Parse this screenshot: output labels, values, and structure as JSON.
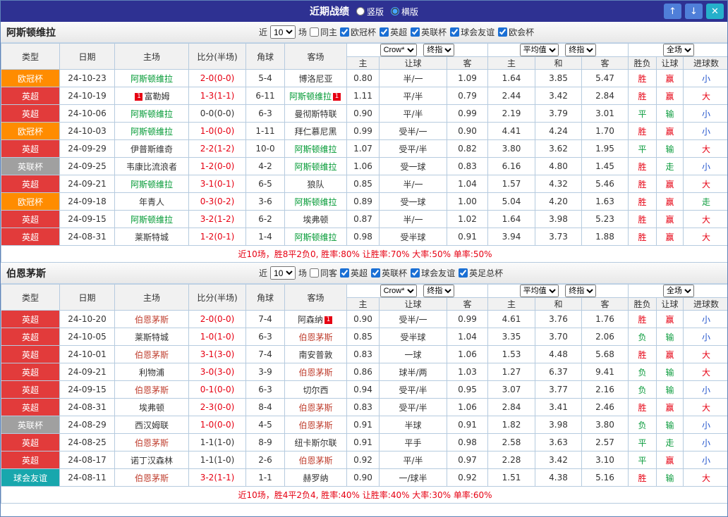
{
  "titlebar": {
    "title": "近期战绩",
    "layout_options": [
      {
        "label": "竖版",
        "selected": false
      },
      {
        "label": "横版",
        "selected": true
      }
    ],
    "buttons": {
      "up": "↑",
      "down": "↓",
      "close": "✕"
    }
  },
  "thead": {
    "type": "类型",
    "date": "日期",
    "home": "主场",
    "score": "比分(半场)",
    "corner": "角球",
    "away": "客场",
    "odds_home": "主",
    "odds_handicap": "让球",
    "odds_away": "客",
    "avg_home": "主",
    "avg_draw": "和",
    "avg_away": "客",
    "res_wl": "胜负",
    "res_handicap": "让球",
    "res_goals": "进球数"
  },
  "colors": {
    "league": {
      "欧冠杯": "#ff8c00",
      "英超": "#e23b3b",
      "英联杯": "#a0a0a0",
      "球会友谊": "#18a7ad"
    },
    "result": {
      "胜": "#e60012",
      "平": "#0a9b3c",
      "负": "#0a9b3c",
      "赢": "#e60012",
      "输": "#0a9b3c",
      "走": "#0a9b3c",
      "大": "#e60012",
      "小": "#2153cc"
    },
    "score_red": "#e60012",
    "score_plain": "#333333",
    "badge": "#e60012"
  },
  "sections": [
    {
      "team": "阿斯顿维拉",
      "team_color": "#009933",
      "filter": {
        "near": "近",
        "count": "10",
        "games": "场",
        "same": {
          "label": "同主",
          "checked": false
        },
        "leagues": [
          {
            "label": "欧冠杯",
            "checked": true
          },
          {
            "label": "英超",
            "checked": true
          },
          {
            "label": "英联杯",
            "checked": true
          },
          {
            "label": "球会友谊",
            "checked": true
          },
          {
            "label": "欧会杯",
            "checked": true
          }
        ]
      },
      "selects": {
        "odds_source": "Crow*",
        "odds_time": "终指",
        "avg_source": "平均值",
        "avg_time": "终指",
        "scope": "全场"
      },
      "rows": [
        {
          "type": "欧冠杯",
          "date": "24-10-23",
          "home": "阿斯顿维拉",
          "homeFocus": true,
          "score": "2-0(0-0)",
          "scoreRed": true,
          "corner": "5-4",
          "away": "博洛尼亚",
          "odds": [
            "0.80",
            "半/一",
            "1.09"
          ],
          "avg": [
            "1.64",
            "3.85",
            "5.47"
          ],
          "res": [
            "胜",
            "赢",
            "小"
          ]
        },
        {
          "type": "英超",
          "date": "24-10-19",
          "home": "富勒姆",
          "homeBadge": "1",
          "homeBadgeSide": "left",
          "score": "1-3(1-1)",
          "scoreRed": true,
          "corner": "6-11",
          "away": "阿斯顿维拉",
          "awayFocus": true,
          "awayBadge": "1",
          "awayBadgeSide": "right",
          "odds": [
            "1.11",
            "平/半",
            "0.79"
          ],
          "avg": [
            "2.44",
            "3.42",
            "2.84"
          ],
          "res": [
            "胜",
            "赢",
            "大"
          ]
        },
        {
          "type": "英超",
          "date": "24-10-06",
          "home": "阿斯顿维拉",
          "homeFocus": true,
          "score": "0-0(0-0)",
          "scoreRed": false,
          "corner": "6-3",
          "away": "曼彻斯特联",
          "odds": [
            "0.90",
            "平/半",
            "0.99"
          ],
          "avg": [
            "2.19",
            "3.79",
            "3.01"
          ],
          "res": [
            "平",
            "输",
            "小"
          ]
        },
        {
          "type": "欧冠杯",
          "date": "24-10-03",
          "home": "阿斯顿维拉",
          "homeFocus": true,
          "score": "1-0(0-0)",
          "scoreRed": true,
          "corner": "1-11",
          "away": "拜仁慕尼黑",
          "odds": [
            "0.99",
            "受半/一",
            "0.90"
          ],
          "avg": [
            "4.41",
            "4.24",
            "1.70"
          ],
          "res": [
            "胜",
            "赢",
            "小"
          ]
        },
        {
          "type": "英超",
          "date": "24-09-29",
          "home": "伊普斯维奇",
          "score": "2-2(1-2)",
          "scoreRed": true,
          "corner": "10-0",
          "away": "阿斯顿维拉",
          "awayFocus": true,
          "odds": [
            "1.07",
            "受平/半",
            "0.82"
          ],
          "avg": [
            "3.80",
            "3.62",
            "1.95"
          ],
          "res": [
            "平",
            "输",
            "大"
          ]
        },
        {
          "type": "英联杯",
          "date": "24-09-25",
          "home": "韦康比流浪者",
          "score": "1-2(0-0)",
          "scoreRed": true,
          "corner": "4-2",
          "away": "阿斯顿维拉",
          "awayFocus": true,
          "odds": [
            "1.06",
            "受一球",
            "0.83"
          ],
          "avg": [
            "6.16",
            "4.80",
            "1.45"
          ],
          "res": [
            "胜",
            "走",
            "小"
          ]
        },
        {
          "type": "英超",
          "date": "24-09-21",
          "home": "阿斯顿维拉",
          "homeFocus": true,
          "score": "3-1(0-1)",
          "scoreRed": true,
          "corner": "6-5",
          "away": "狼队",
          "odds": [
            "0.85",
            "半/一",
            "1.04"
          ],
          "avg": [
            "1.57",
            "4.32",
            "5.46"
          ],
          "res": [
            "胜",
            "赢",
            "大"
          ]
        },
        {
          "type": "欧冠杯",
          "date": "24-09-18",
          "home": "年青人",
          "score": "0-3(0-2)",
          "scoreRed": true,
          "corner": "3-6",
          "away": "阿斯顿维拉",
          "awayFocus": true,
          "odds": [
            "0.89",
            "受一球",
            "1.00"
          ],
          "avg": [
            "5.04",
            "4.20",
            "1.63"
          ],
          "res": [
            "胜",
            "赢",
            "走"
          ]
        },
        {
          "type": "英超",
          "date": "24-09-15",
          "home": "阿斯顿维拉",
          "homeFocus": true,
          "score": "3-2(1-2)",
          "scoreRed": true,
          "corner": "6-2",
          "away": "埃弗顿",
          "odds": [
            "0.87",
            "半/一",
            "1.02"
          ],
          "avg": [
            "1.64",
            "3.98",
            "5.23"
          ],
          "res": [
            "胜",
            "赢",
            "大"
          ]
        },
        {
          "type": "英超",
          "date": "24-08-31",
          "home": "莱斯特城",
          "score": "1-2(0-1)",
          "scoreRed": true,
          "corner": "1-4",
          "away": "阿斯顿维拉",
          "awayFocus": true,
          "odds": [
            "0.98",
            "受半球",
            "0.91"
          ],
          "avg": [
            "3.94",
            "3.73",
            "1.88"
          ],
          "res": [
            "胜",
            "赢",
            "大"
          ]
        }
      ],
      "summary": "近10场，胜8平2负0, 胜率:80% 让胜率:70% 大率:50% 单率:50%"
    },
    {
      "team": "伯恩茅斯",
      "team_color": "#c04030",
      "filter": {
        "near": "近",
        "count": "10",
        "games": "场",
        "same": {
          "label": "同客",
          "checked": false
        },
        "leagues": [
          {
            "label": "英超",
            "checked": true
          },
          {
            "label": "英联杯",
            "checked": true
          },
          {
            "label": "球会友谊",
            "checked": true
          },
          {
            "label": "英足总杯",
            "checked": true
          }
        ]
      },
      "selects": {
        "odds_source": "Crow*",
        "odds_time": "终指",
        "avg_source": "平均值",
        "avg_time": "终指",
        "scope": "全场"
      },
      "rows": [
        {
          "type": "英超",
          "date": "24-10-20",
          "home": "伯恩茅斯",
          "homeFocus": true,
          "score": "2-0(0-0)",
          "scoreRed": true,
          "corner": "7-4",
          "away": "阿森纳",
          "awayBadge": "1",
          "awayBadgeSide": "right",
          "odds": [
            "0.90",
            "受半/一",
            "0.99"
          ],
          "avg": [
            "4.61",
            "3.76",
            "1.76"
          ],
          "res": [
            "胜",
            "赢",
            "小"
          ]
        },
        {
          "type": "英超",
          "date": "24-10-05",
          "home": "莱斯特城",
          "score": "1-0(1-0)",
          "scoreRed": true,
          "corner": "6-3",
          "away": "伯恩茅斯",
          "awayFocus": true,
          "odds": [
            "0.85",
            "受半球",
            "1.04"
          ],
          "avg": [
            "3.35",
            "3.70",
            "2.06"
          ],
          "res": [
            "负",
            "输",
            "小"
          ]
        },
        {
          "type": "英超",
          "date": "24-10-01",
          "home": "伯恩茅斯",
          "homeFocus": true,
          "score": "3-1(3-0)",
          "scoreRed": true,
          "corner": "7-4",
          "away": "南安普敦",
          "odds": [
            "0.83",
            "一球",
            "1.06"
          ],
          "avg": [
            "1.53",
            "4.48",
            "5.68"
          ],
          "res": [
            "胜",
            "赢",
            "大"
          ]
        },
        {
          "type": "英超",
          "date": "24-09-21",
          "home": "利物浦",
          "score": "3-0(3-0)",
          "scoreRed": true,
          "corner": "3-9",
          "away": "伯恩茅斯",
          "awayFocus": true,
          "odds": [
            "0.86",
            "球半/两",
            "1.03"
          ],
          "avg": [
            "1.27",
            "6.37",
            "9.41"
          ],
          "res": [
            "负",
            "输",
            "大"
          ]
        },
        {
          "type": "英超",
          "date": "24-09-15",
          "home": "伯恩茅斯",
          "homeFocus": true,
          "score": "0-1(0-0)",
          "scoreRed": true,
          "corner": "6-3",
          "away": "切尔西",
          "odds": [
            "0.94",
            "受平/半",
            "0.95"
          ],
          "avg": [
            "3.07",
            "3.77",
            "2.16"
          ],
          "res": [
            "负",
            "输",
            "小"
          ]
        },
        {
          "type": "英超",
          "date": "24-08-31",
          "home": "埃弗顿",
          "score": "2-3(0-0)",
          "scoreRed": true,
          "corner": "8-4",
          "away": "伯恩茅斯",
          "awayFocus": true,
          "odds": [
            "0.83",
            "受平/半",
            "1.06"
          ],
          "avg": [
            "2.84",
            "3.41",
            "2.46"
          ],
          "res": [
            "胜",
            "赢",
            "大"
          ]
        },
        {
          "type": "英联杯",
          "date": "24-08-29",
          "home": "西汉姆联",
          "score": "1-0(0-0)",
          "scoreRed": true,
          "corner": "4-5",
          "away": "伯恩茅斯",
          "awayFocus": true,
          "odds": [
            "0.91",
            "半球",
            "0.91"
          ],
          "avg": [
            "1.82",
            "3.98",
            "3.80"
          ],
          "res": [
            "负",
            "输",
            "小"
          ]
        },
        {
          "type": "英超",
          "date": "24-08-25",
          "home": "伯恩茅斯",
          "homeFocus": true,
          "score": "1-1(1-0)",
          "scoreRed": false,
          "corner": "8-9",
          "away": "纽卡斯尔联",
          "odds": [
            "0.91",
            "平手",
            "0.98"
          ],
          "avg": [
            "2.58",
            "3.63",
            "2.57"
          ],
          "res": [
            "平",
            "走",
            "小"
          ]
        },
        {
          "type": "英超",
          "date": "24-08-17",
          "home": "诺丁汉森林",
          "score": "1-1(1-0)",
          "scoreRed": false,
          "corner": "2-6",
          "away": "伯恩茅斯",
          "awayFocus": true,
          "odds": [
            "0.92",
            "平/半",
            "0.97"
          ],
          "avg": [
            "2.28",
            "3.42",
            "3.10"
          ],
          "res": [
            "平",
            "赢",
            "小"
          ]
        },
        {
          "type": "球会友谊",
          "date": "24-08-11",
          "home": "伯恩茅斯",
          "homeFocus": true,
          "score": "3-2(1-1)",
          "scoreRed": true,
          "corner": "1-1",
          "away": "赫罗纳",
          "odds": [
            "0.90",
            "一/球半",
            "0.92"
          ],
          "avg": [
            "1.51",
            "4.38",
            "5.16"
          ],
          "res": [
            "胜",
            "输",
            "大"
          ]
        }
      ],
      "summary": "近10场，胜4平2负4, 胜率:40% 让胜率:40% 大率:30% 单率:60%"
    }
  ]
}
